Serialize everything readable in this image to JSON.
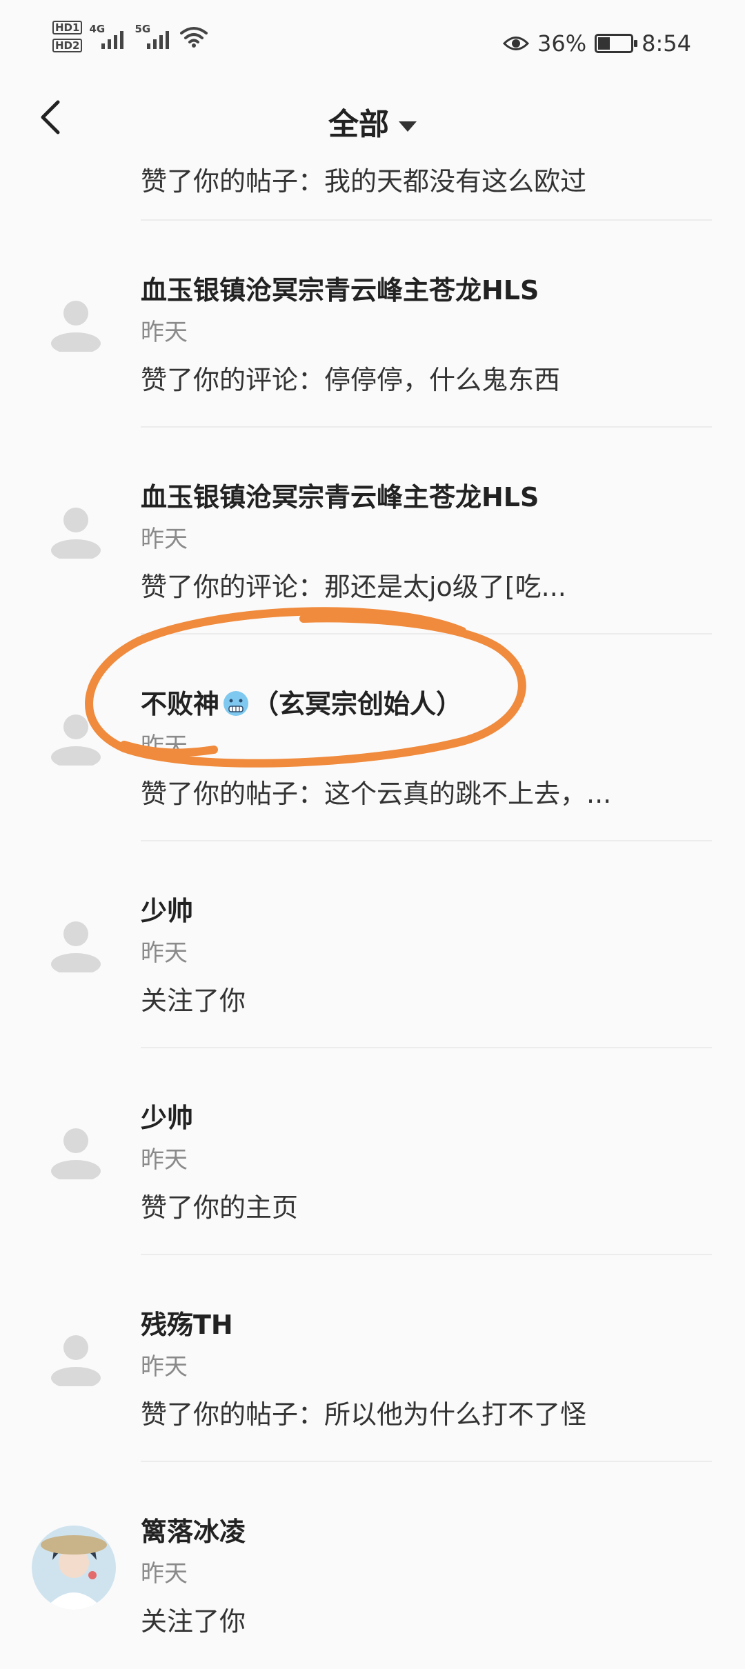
{
  "status": {
    "hd1": "HD1",
    "hd2": "HD2",
    "net1": "4G",
    "net2": "5G",
    "battery_percent": "36%",
    "battery_level": 0.36,
    "time": "8:54"
  },
  "header": {
    "title": "全部"
  },
  "top_partial": {
    "message": "赞了你的帖子：我的天都没有这么欧过"
  },
  "items": [
    {
      "name": "血玉银镇沧冥宗青云峰主苍龙HLS",
      "time": "昨天",
      "message": "赞了你的评论：停停停，什么鬼东西"
    },
    {
      "name": "血玉银镇沧冥宗青云峰主苍龙HLS",
      "time": "昨天",
      "message": "赞了你的评论：那还是太jo级了[吃..."
    },
    {
      "name_prefix": "不败神",
      "name_suffix": "（玄冥宗创始人）",
      "emoji": "cold-face-emoji",
      "time": "昨天",
      "message": "赞了你的帖子：这个云真的跳不上去，..."
    },
    {
      "name": "少帅",
      "time": "昨天",
      "message": "关注了你"
    },
    {
      "name": "少帅",
      "time": "昨天",
      "message": "赞了你的主页"
    },
    {
      "name": "残殇TH",
      "time": "昨天",
      "message": "赞了你的帖子：所以他为什么打不了怪"
    },
    {
      "name": "篱落冰凌",
      "time": "昨天",
      "message": "关注了你"
    }
  ],
  "colors": {
    "highlight": "#f08a3c",
    "avatar_placeholder": "#d9d9d9"
  }
}
